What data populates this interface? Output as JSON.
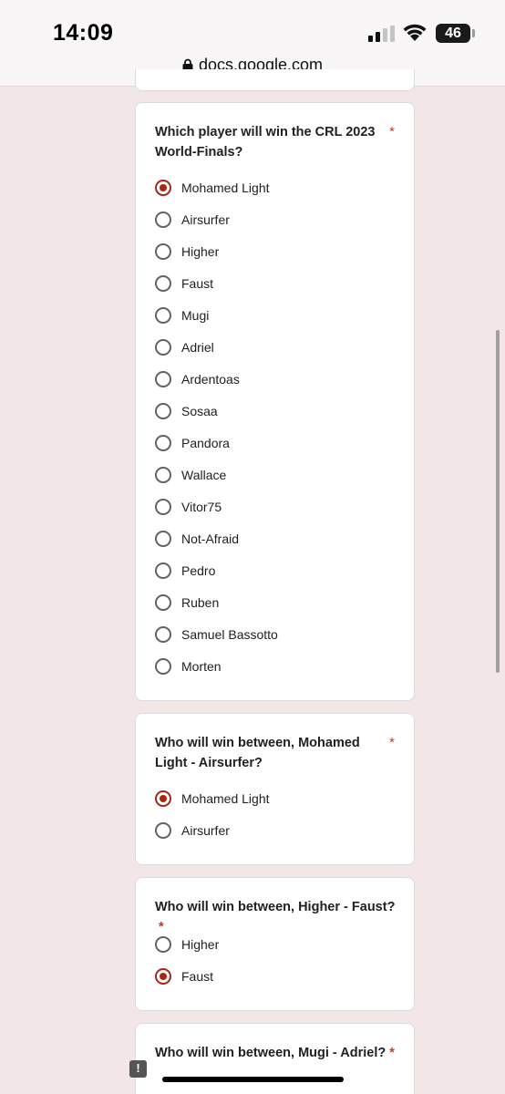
{
  "status": {
    "time": "14:09",
    "battery": "46"
  },
  "browser": {
    "url": "docs.google.com"
  },
  "colors": {
    "page_background": "#f3e6e6",
    "accent": "#a52714",
    "required": "#d93025"
  },
  "form": {
    "q1": {
      "question": "Which player will win the CRL 2023 World-Finals?",
      "required_mark": "*",
      "selected": "Mohamed Light",
      "options": [
        {
          "label": "Mohamed Light",
          "checked": true
        },
        {
          "label": "Airsurfer",
          "checked": false
        },
        {
          "label": "Higher",
          "checked": false
        },
        {
          "label": "Faust",
          "checked": false
        },
        {
          "label": "Mugi",
          "checked": false
        },
        {
          "label": "Adriel",
          "checked": false
        },
        {
          "label": "Ardentoas",
          "checked": false
        },
        {
          "label": "Sosaa",
          "checked": false
        },
        {
          "label": "Pandora",
          "checked": false
        },
        {
          "label": "Wallace",
          "checked": false
        },
        {
          "label": "Vitor75",
          "checked": false
        },
        {
          "label": "Not-Afraid",
          "checked": false
        },
        {
          "label": "Pedro",
          "checked": false
        },
        {
          "label": "Ruben",
          "checked": false
        },
        {
          "label": "Samuel Bassotto",
          "checked": false
        },
        {
          "label": "Morten",
          "checked": false
        }
      ]
    },
    "q2": {
      "question": "Who will win between, Mohamed Light - Airsurfer?",
      "required_mark": "*",
      "options": [
        {
          "label": "Mohamed Light",
          "checked": true
        },
        {
          "label": "Airsurfer",
          "checked": false
        }
      ]
    },
    "q3": {
      "question": "Who will win between, Higher - Faust?",
      "required_mark": "*",
      "options": [
        {
          "label": "Higher",
          "checked": false
        },
        {
          "label": "Faust",
          "checked": true
        }
      ]
    },
    "q4": {
      "question": "Who will win between, Mugi - Adriel?",
      "required_mark": "*"
    }
  },
  "icons": {
    "feedback": "report-issue-icon",
    "lock": "lock-icon"
  },
  "feedback_glyph": "!"
}
